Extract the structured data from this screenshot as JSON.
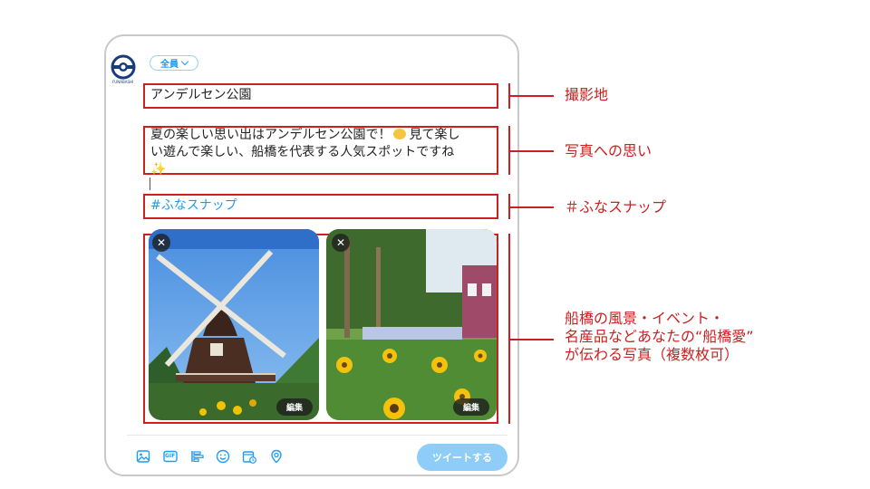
{
  "compose": {
    "logo_text": "FUNABASHI",
    "audience_label": "全員",
    "location_text": "アンデルセン公園",
    "message_line1": "夏の楽しい思い出はアンデルセン公園で！",
    "message_line1_tail": "見て楽し",
    "message_line2": "い遊んで楽しい、船橋を代表する人気スポットですね",
    "message_line3_emoji": "✨",
    "hashtag": "#ふなスナップ",
    "photos": [
      {
        "close_label": "✕",
        "edit_label": "編集"
      },
      {
        "close_label": "✕",
        "edit_label": "編集"
      }
    ],
    "tweet_button": "ツイートする"
  },
  "toolbar": {
    "icons": [
      "image-icon",
      "gif-icon",
      "poll-icon",
      "emoji-icon",
      "schedule-icon",
      "location-icon"
    ],
    "gif_label": "GIF"
  },
  "annotations": {
    "location": "撮影地",
    "message": "写真への思い",
    "hashtag": "＃ふなスナップ",
    "photos_line1": "船橋の風景・イベント・",
    "photos_line2": "名産品などあなたの“船橋愛”",
    "photos_line3": "が伝わる写真（複数枚可）"
  },
  "colors": {
    "accent": "#1d9bf0",
    "annotation_red": "#cc1f1f",
    "tweet_button": "#8ecdf8"
  }
}
